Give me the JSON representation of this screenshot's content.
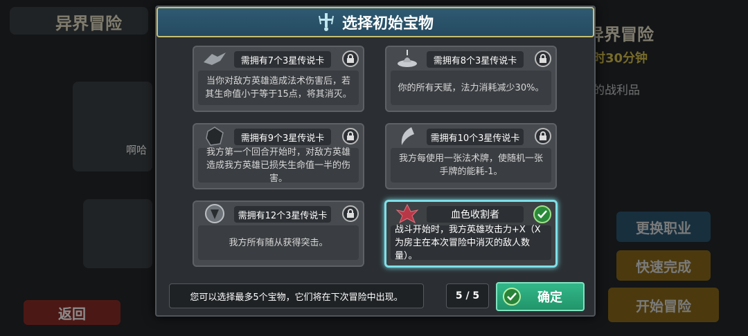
{
  "background": {
    "left_title": "异界冒险",
    "right_title": "初级异界冒险",
    "timer": "时30分钟",
    "loot_label": "的战利品",
    "player_name": "啊哈",
    "back_label": "返回",
    "change_class": "更换职业",
    "quick_finish": "快速完成",
    "start_adventure": "开始冒险"
  },
  "dialog": {
    "title": "选择初始宝物",
    "cards": [
      {
        "req": "需拥有7个3星传说卡",
        "desc": "当你对敌方英雄造成法术伤害后，若其生命值小于等于15点，将其消灭。",
        "locked": true
      },
      {
        "req": "需拥有8个3星传说卡",
        "desc": "你的所有天赋，法力消耗减少30%。",
        "locked": true
      },
      {
        "req": "需拥有9个3星传说卡",
        "desc": "我方第一个回合开始时，对敌方英雄造成我方英雄已损失生命值一半的伤害。",
        "locked": true
      },
      {
        "req": "需拥有10个3星传说卡",
        "desc": "我方每使用一张法术牌，使随机一张手牌的能耗-1。",
        "locked": true
      },
      {
        "req": "需拥有12个3星传说卡",
        "desc": "我方所有随从获得突击。",
        "locked": true
      },
      {
        "req": "血色收割者",
        "desc": "战斗开始时，我方英雄攻击力+X（X为房主在本次冒险中消灭的敌人数量）。",
        "locked": false,
        "selected": true
      }
    ],
    "footer_note": "您可以选择最多5个宝物，它们将在下次冒险中出现。",
    "counter": "5 / 5",
    "confirm": "确定"
  }
}
